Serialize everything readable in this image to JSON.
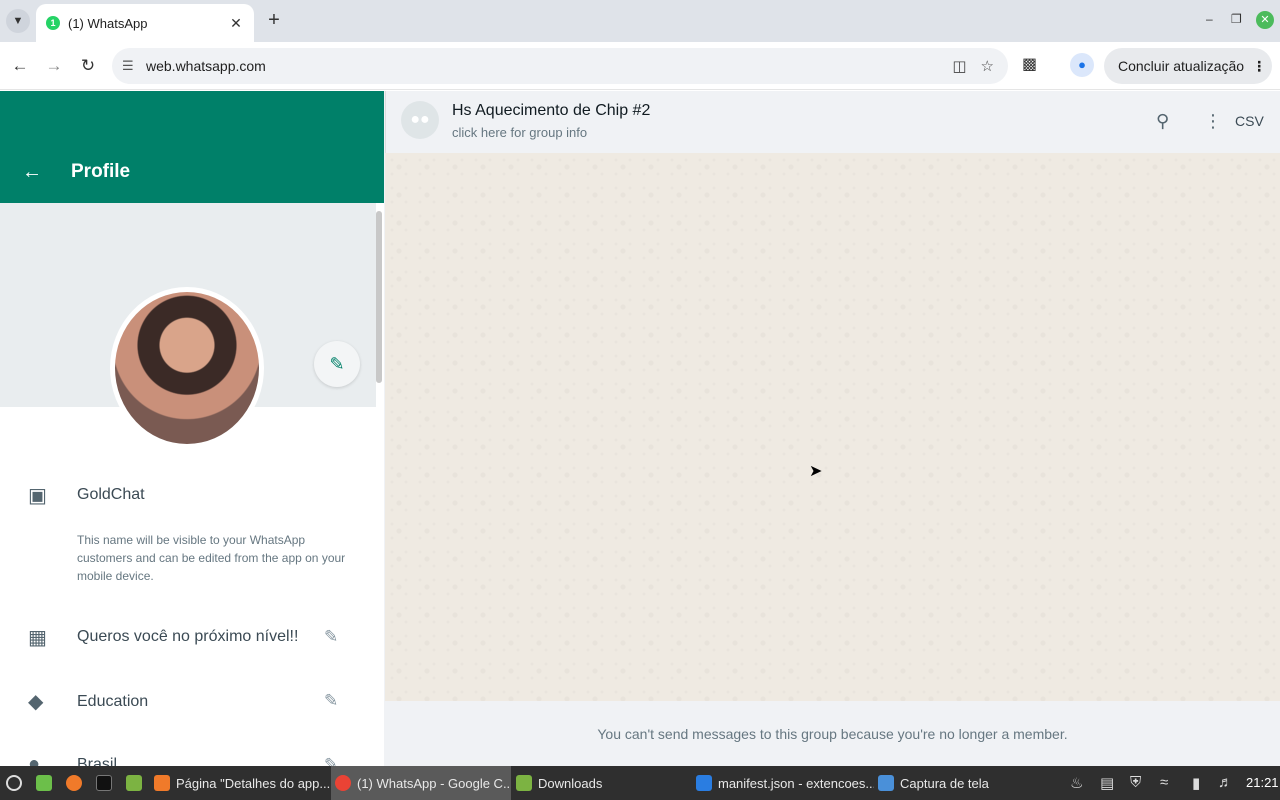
{
  "browser": {
    "tab_title": "(1) WhatsApp",
    "url": "web.whatsapp.com",
    "update_label": "Concluir atualização"
  },
  "profile_panel": {
    "title": "Profile",
    "name": "GoldChat",
    "name_note": "This name will be visible to your WhatsApp customers and can be edited from the app on your mobile device.",
    "description": "Queros você no próximo nível!!",
    "category": "Education",
    "location": "Brasil"
  },
  "chat": {
    "group_name": "Hs Aquecimento de Chip #2",
    "group_sub": "click here for group info",
    "csv_label": "CSV",
    "footer_text": "You can't send messages to this group because you're no longer a member."
  },
  "taskbar": {
    "items": [
      "Página \"Detalhes do app...",
      "(1) WhatsApp - Google C...",
      "Downloads",
      "manifest.json - extencoes...",
      "Captura de tela"
    ],
    "clock": "21:21"
  }
}
